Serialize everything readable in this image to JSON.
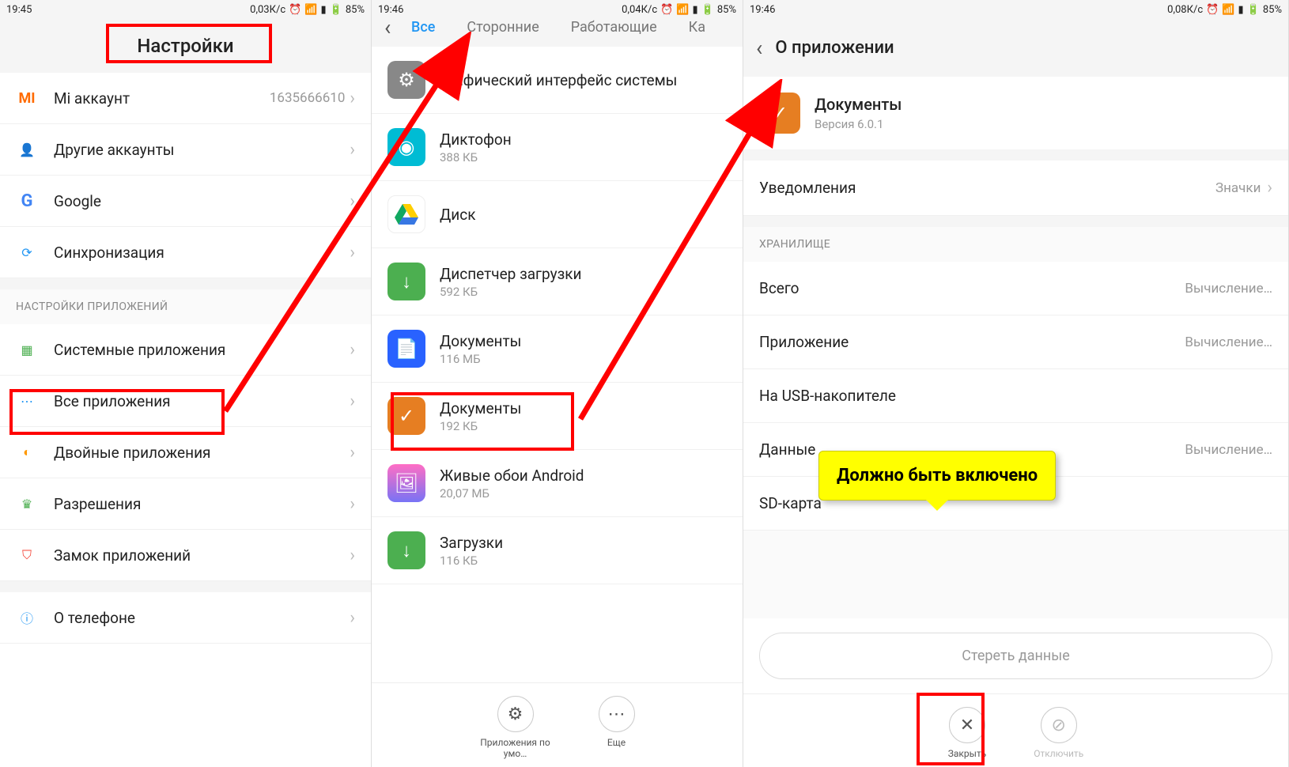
{
  "screen1": {
    "status": {
      "time": "19:45",
      "speed": "0,03К/с",
      "battery": "85%"
    },
    "title": "Настройки",
    "items": [
      {
        "label": "Mi аккаунт",
        "value": "1635666610"
      },
      {
        "label": "Другие аккаунты"
      },
      {
        "label": "Google"
      },
      {
        "label": "Синхронизация"
      }
    ],
    "section": "НАСТРОЙКИ ПРИЛОЖЕНИЙ",
    "items2": [
      {
        "label": "Системные приложения"
      },
      {
        "label": "Все приложения"
      },
      {
        "label": "Двойные приложения"
      },
      {
        "label": "Разрешения"
      },
      {
        "label": "Замок приложений"
      },
      {
        "label": "О телефоне"
      }
    ]
  },
  "screen2": {
    "status": {
      "time": "19:46",
      "speed": "0,04К/с",
      "battery": "85%"
    },
    "tabs": [
      "Все",
      "Сторонние",
      "Работающие",
      "Ка"
    ],
    "apps": [
      {
        "name": "Графический интерфейс системы",
        "size": ""
      },
      {
        "name": "Диктофон",
        "size": "388 КБ"
      },
      {
        "name": "Диск",
        "size": ""
      },
      {
        "name": "Диспетчер загрузки",
        "size": "592 КБ"
      },
      {
        "name": "Документы",
        "size": "116 МБ"
      },
      {
        "name": "Документы",
        "size": "192 КБ"
      },
      {
        "name": "Живые обои Android",
        "size": "20,07 МБ"
      },
      {
        "name": "Загрузки",
        "size": "116 КБ"
      }
    ],
    "bottom": {
      "default": "Приложения по умо…",
      "more": "Еще"
    }
  },
  "screen3": {
    "status": {
      "time": "19:46",
      "speed": "0,08К/с",
      "battery": "85%"
    },
    "title": "О приложении",
    "app": {
      "name": "Документы",
      "version": "Версия 6.0.1"
    },
    "notifications": {
      "label": "Уведомления",
      "value": "Значки"
    },
    "storage_section": "ХРАНИЛИЩЕ",
    "storage": [
      {
        "label": "Всего",
        "value": "Вычисление…"
      },
      {
        "label": "Приложение",
        "value": "Вычисление…"
      },
      {
        "label": "На USB-накопителе",
        "value": ""
      },
      {
        "label": "Данные",
        "value": "Вычисление…"
      },
      {
        "label": "SD-карта",
        "value": ""
      }
    ],
    "erase": "Стереть данные",
    "bottom": {
      "close": "Закрыть",
      "disable": "Отключить"
    }
  },
  "tooltip": "Должно быть включено"
}
